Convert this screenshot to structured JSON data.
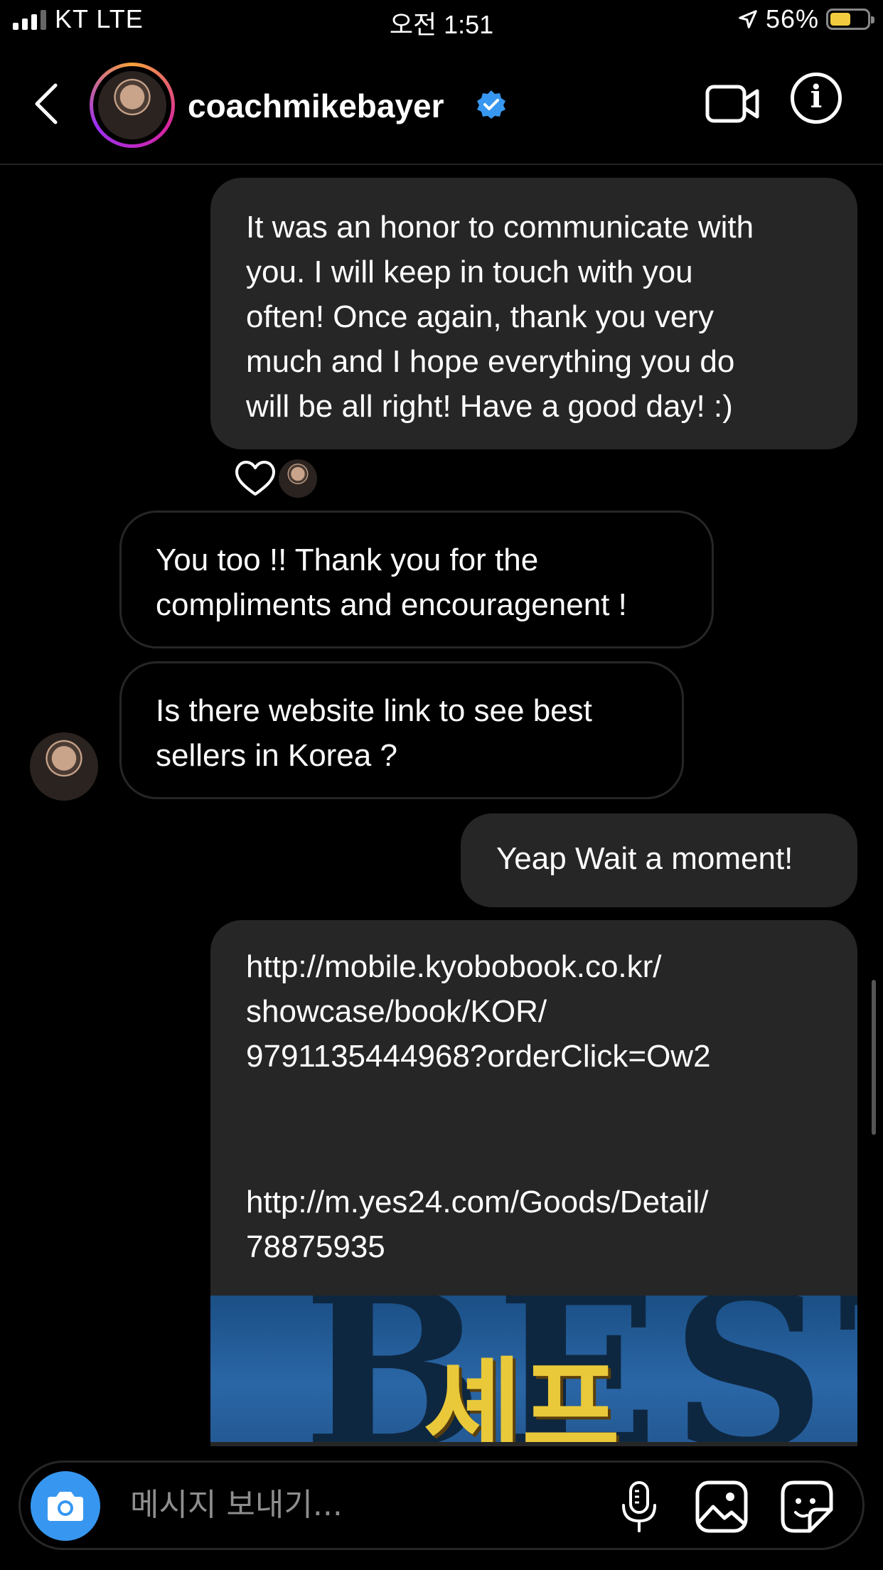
{
  "status_bar": {
    "carrier": "KT LTE",
    "time": "오전 1:51",
    "battery_percent": "56%",
    "battery_level": 0.56,
    "battery_color": "#f2cc3e"
  },
  "header": {
    "username": "coachmikebayer",
    "verified": true,
    "icons": [
      "back-chevron-icon",
      "verified-badge-icon",
      "video-call-icon",
      "info-icon"
    ]
  },
  "messages": [
    {
      "direction": "sent",
      "text_lines": [
        "It was an honor to communicate with",
        "you. I will keep in touch with you",
        "often! Once again, thank you very",
        "much and I hope everything you do",
        "will be all right! Have a good day! :)"
      ]
    },
    {
      "direction": "received",
      "text_lines": [
        "You too !! Thank you for the",
        "compliments and encouragenent !"
      ]
    },
    {
      "direction": "received",
      "text_lines": [
        "Is there website link to see best",
        "sellers in Korea ?"
      ]
    },
    {
      "direction": "sent",
      "text": "Yeap Wait a moment!"
    },
    {
      "direction": "sent",
      "link1_lines": [
        "http://mobile.kyobobook.co.kr/",
        "showcase/book/KOR/",
        "9791135444968?orderClick=Ow2"
      ],
      "link2_lines": [
        "http://m.yes24.com/Goods/Detail/",
        "78875935"
      ],
      "preview_text": "셰프"
    }
  ],
  "composer": {
    "placeholder": "메시지 보내기...",
    "accent_color": "#3797f0"
  }
}
